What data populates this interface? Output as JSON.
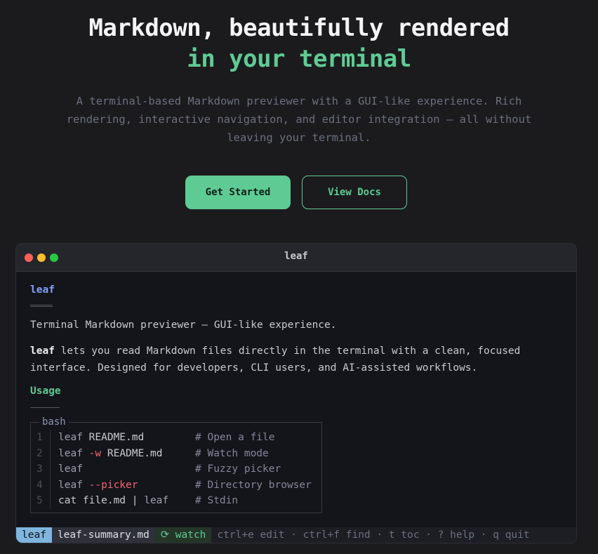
{
  "hero": {
    "title_line1": "Markdown, beautifully rendered",
    "title_line2": "in your terminal",
    "subtitle": "A terminal-based Markdown previewer with a GUI-like experience. Rich rendering, interactive navigation, and editor integration — all without leaving your terminal.",
    "primary_button": "Get Started",
    "secondary_button": "View Docs"
  },
  "terminal": {
    "window_title": "leaf",
    "heading": "leaf",
    "tagline": "Terminal Markdown previewer — GUI-like experience.",
    "intro_bold": "leaf",
    "intro_rest": " lets you read Markdown files directly in the terminal with a clean, focused interface. Designed for developers, CLI users, and AI-assisted workflows.",
    "usage_heading": "Usage",
    "code_lang": "bash",
    "code_lines": [
      {
        "n": "1",
        "pre": "leaf",
        "flag": "",
        "post": " README.md",
        "comment": "# Open a file"
      },
      {
        "n": "2",
        "pre": "leaf",
        "flag": " -w",
        "post": " README.md",
        "comment": "# Watch mode"
      },
      {
        "n": "3",
        "pre": "leaf",
        "flag": "",
        "post": "",
        "comment": "# Fuzzy picker"
      },
      {
        "n": "4",
        "pre": "leaf",
        "flag": " --picker",
        "post": "",
        "comment": "# Directory browser"
      },
      {
        "n": "5",
        "pre": "cat file.md | ",
        "flag": "",
        "post": "",
        "comment": "# Stdin",
        "tail": "leaf"
      }
    ],
    "status": {
      "mode": "leaf",
      "file": "leaf-summary.md",
      "watch": "⟳ watch",
      "keys": "ctrl+e edit · ctrl+f find · t toc · ? help · q quit"
    }
  },
  "colors": {
    "accent": "#5fcb94",
    "heading_blue": "#7ea2f7",
    "flag_red": "#f4676e",
    "background": "#1b1b1e"
  }
}
